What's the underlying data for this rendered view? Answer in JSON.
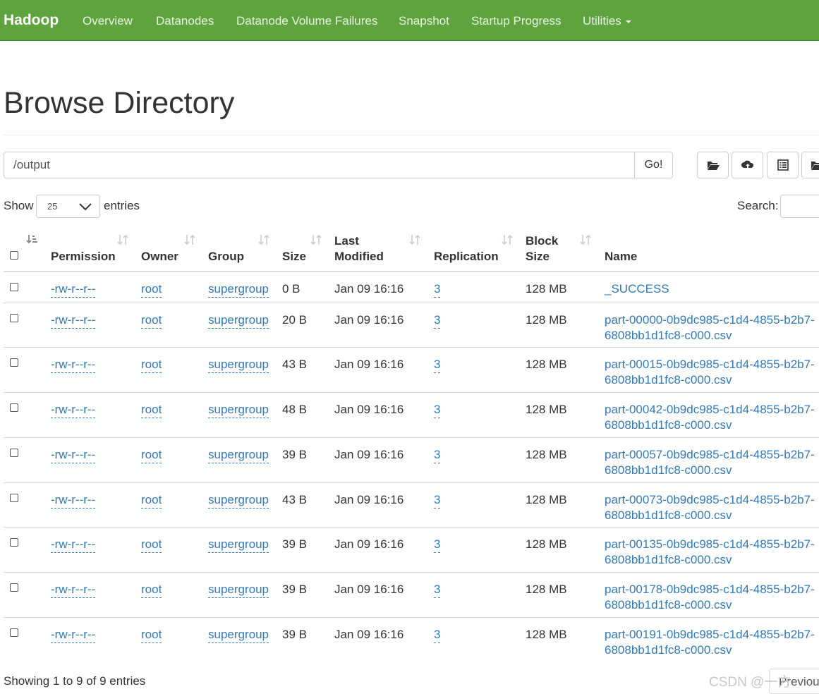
{
  "navbar": {
    "brand": "Hadoop",
    "items": [
      "Overview",
      "Datanodes",
      "Datanode Volume Failures",
      "Snapshot",
      "Startup Progress",
      "Utilities"
    ]
  },
  "page_title": "Browse Directory",
  "path_bar": {
    "value": "/output",
    "go_label": "Go!"
  },
  "toolbar_icons": [
    "folder-open-icon",
    "cloud-upload-icon",
    "list-icon",
    "folder-icon"
  ],
  "length_menu": {
    "show": "Show",
    "value": "25",
    "entries": "entries"
  },
  "search": {
    "label": "Search:"
  },
  "columns": [
    "Permission",
    "Owner",
    "Group",
    "Size",
    "Last Modified",
    "Replication",
    "Block Size",
    "Name"
  ],
  "rows": [
    {
      "permission": "-rw-r--r--",
      "owner": "root",
      "group": "supergroup",
      "size": "0 B",
      "modified": "Jan 09 16:16",
      "replication": "3",
      "block_size": "128 MB",
      "name": "_SUCCESS"
    },
    {
      "permission": "-rw-r--r--",
      "owner": "root",
      "group": "supergroup",
      "size": "20 B",
      "modified": "Jan 09 16:16",
      "replication": "3",
      "block_size": "128 MB",
      "name": "part-00000-0b9dc985-c1d4-4855-b2b7-6808bb1d1fc8-c000.csv"
    },
    {
      "permission": "-rw-r--r--",
      "owner": "root",
      "group": "supergroup",
      "size": "43 B",
      "modified": "Jan 09 16:16",
      "replication": "3",
      "block_size": "128 MB",
      "name": "part-00015-0b9dc985-c1d4-4855-b2b7-6808bb1d1fc8-c000.csv"
    },
    {
      "permission": "-rw-r--r--",
      "owner": "root",
      "group": "supergroup",
      "size": "48 B",
      "modified": "Jan 09 16:16",
      "replication": "3",
      "block_size": "128 MB",
      "name": "part-00042-0b9dc985-c1d4-4855-b2b7-6808bb1d1fc8-c000.csv"
    },
    {
      "permission": "-rw-r--r--",
      "owner": "root",
      "group": "supergroup",
      "size": "39 B",
      "modified": "Jan 09 16:16",
      "replication": "3",
      "block_size": "128 MB",
      "name": "part-00057-0b9dc985-c1d4-4855-b2b7-6808bb1d1fc8-c000.csv"
    },
    {
      "permission": "-rw-r--r--",
      "owner": "root",
      "group": "supergroup",
      "size": "43 B",
      "modified": "Jan 09 16:16",
      "replication": "3",
      "block_size": "128 MB",
      "name": "part-00073-0b9dc985-c1d4-4855-b2b7-6808bb1d1fc8-c000.csv"
    },
    {
      "permission": "-rw-r--r--",
      "owner": "root",
      "group": "supergroup",
      "size": "39 B",
      "modified": "Jan 09 16:16",
      "replication": "3",
      "block_size": "128 MB",
      "name": "part-00135-0b9dc985-c1d4-4855-b2b7-6808bb1d1fc8-c000.csv"
    },
    {
      "permission": "-rw-r--r--",
      "owner": "root",
      "group": "supergroup",
      "size": "39 B",
      "modified": "Jan 09 16:16",
      "replication": "3",
      "block_size": "128 MB",
      "name": "part-00178-0b9dc985-c1d4-4855-b2b7-6808bb1d1fc8-c000.csv"
    },
    {
      "permission": "-rw-r--r--",
      "owner": "root",
      "group": "supergroup",
      "size": "39 B",
      "modified": "Jan 09 16:16",
      "replication": "3",
      "block_size": "128 MB",
      "name": "part-00191-0b9dc985-c1d4-4855-b2b7-6808bb1d1fc8-c000.csv"
    }
  ],
  "footer": {
    "info": "Showing 1 to 9 of 9 entries",
    "previous": "Previou"
  },
  "watermark": "CSDN @一方",
  "colors": {
    "navbar": "#5fa33e",
    "link": "#337ab7"
  }
}
